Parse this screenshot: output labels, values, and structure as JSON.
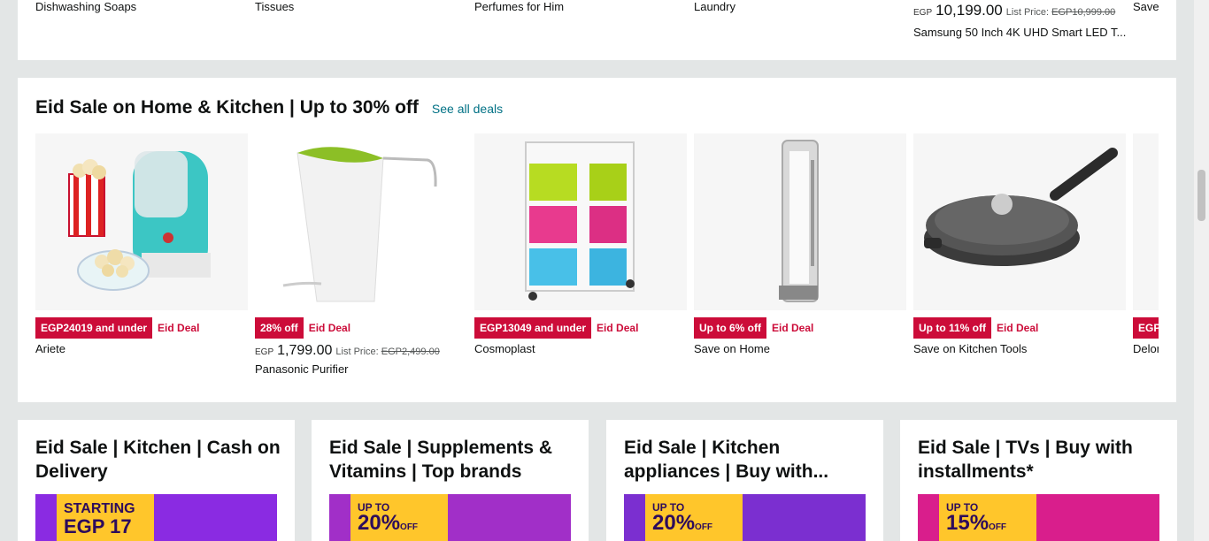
{
  "top_row": {
    "items": [
      {
        "label": "Dishwashing Soaps"
      },
      {
        "label": "Tissues"
      },
      {
        "label": "Perfumes for Him"
      },
      {
        "label": "Laundry"
      }
    ],
    "product": {
      "currency": "EGP",
      "price": "10,199.00",
      "list_price_label": "List Price:",
      "list_price": "EGP10,999.00",
      "title": "Samsung 50 Inch 4K UHD Smart LED T..."
    },
    "cut_label": "Save"
  },
  "deals": {
    "title": "Eid Sale on Home & Kitchen | Up to 30% off",
    "see_all": "See all deals",
    "deal_tag": "Eid Deal",
    "products": [
      {
        "badge": "EGP24019 and under",
        "name": "Ariete",
        "image": "popcorn-maker"
      },
      {
        "badge": "28% off",
        "currency": "EGP",
        "price": "1,799.00",
        "list_price_label": "List Price:",
        "list_price": "EGP2,499.00",
        "name": "Panasonic Purifier",
        "image": "water-purifier"
      },
      {
        "badge": "EGP13049 and under",
        "name": "Cosmoplast",
        "image": "drawer-unit"
      },
      {
        "badge": "Up to 6% off",
        "name": "Save on Home",
        "image": "led-light"
      },
      {
        "badge": "Up to 11% off",
        "name": "Save on Kitchen Tools",
        "image": "frying-pan"
      },
      {
        "badge": "EGP",
        "name": "Delon",
        "image": "partial"
      }
    ]
  },
  "bottom_cards": [
    {
      "title": "Eid Sale | Kitchen | Cash on Delivery",
      "promo_small": "STARTING",
      "promo_big": "EGP 17",
      "bg": "#8a2be2"
    },
    {
      "title": "Eid Sale | Supplements & Vitamins | Top brands",
      "promo_small": "UP TO",
      "promo_big": "20%",
      "promo_pct": "OFF",
      "bg": "#a12fc8"
    },
    {
      "title": "Eid Sale | Kitchen appliances | Buy with...",
      "promo_small": "UP TO",
      "promo_big": "20%",
      "promo_pct": "OFF",
      "bg": "#7b2fd0"
    },
    {
      "title": "Eid Sale | TVs | Buy with installments*",
      "promo_small": "UP TO",
      "promo_big": "15%",
      "promo_pct": "OFF",
      "bg": "#d91e8c"
    }
  ]
}
